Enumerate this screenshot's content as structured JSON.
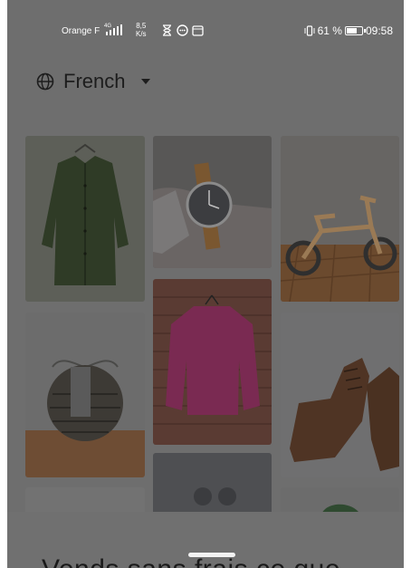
{
  "status_bar": {
    "carrier": "Orange F",
    "network_speed_value": "8,5",
    "network_speed_unit": "K/s",
    "battery_percent": "61 %",
    "time": "09:58"
  },
  "language_selector": {
    "label": "French"
  },
  "gallery": {
    "items": [
      "green-shirt",
      "wrist-watch",
      "balance-bike",
      "wicker-basket",
      "pink-sweater",
      "leather-boots",
      "partial-item-1",
      "partial-item-2",
      "partial-item-3"
    ]
  },
  "headline": "Vends sans frais ce que"
}
